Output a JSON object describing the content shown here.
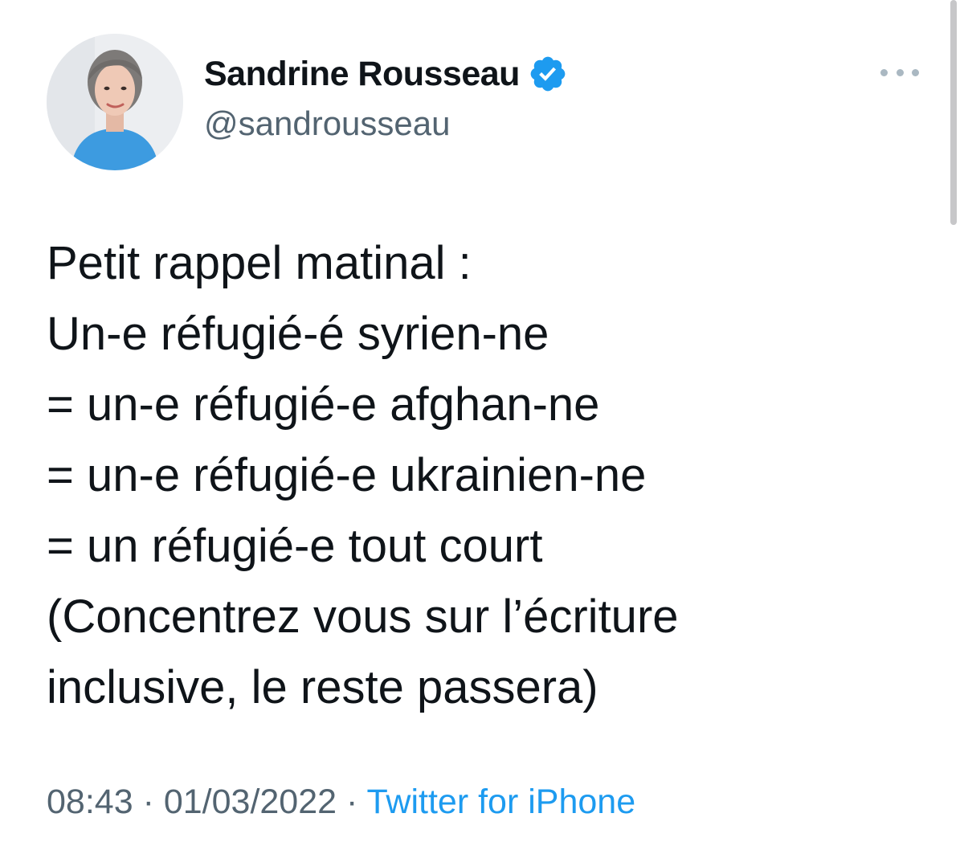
{
  "tweet": {
    "author": {
      "display_name": "Sandrine Rousseau",
      "handle": "@sandrousseau",
      "verified": true,
      "verified_icon": "verified-badge-icon",
      "verified_color": "#1d9bf0"
    },
    "more_icon": "more-options-icon",
    "lines": [
      "Petit rappel matinal :",
      "Un-e réfugié-é syrien-ne",
      "= un-e réfugié-e afghan-ne",
      "= un-e réfugié-e ukrainien-ne",
      "= un réfugié-e tout court",
      "(Concentrez vous sur l’écriture",
      "inclusive, le reste passera)"
    ],
    "time": "08:43",
    "separator": "·",
    "date": "01/03/2022",
    "source": "Twitter for iPhone"
  },
  "colors": {
    "text": "#0f1419",
    "secondary": "#536471",
    "link": "#1d9bf0"
  }
}
